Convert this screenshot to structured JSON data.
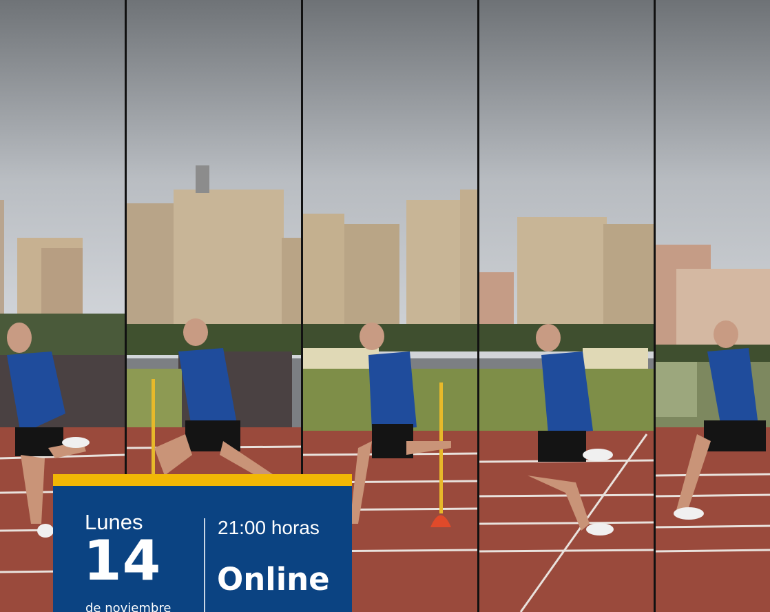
{
  "event": {
    "weekday": "Lunes",
    "day_number": "14",
    "month": "de noviembre",
    "time": "21:00 horas",
    "mode": "Online"
  },
  "colors": {
    "brand_blue": "#0b4382",
    "accent_yellow": "#f2b705",
    "top_bar": "#0b3f7a"
  },
  "photos": [
    {
      "frame": "sprint-frame-1"
    },
    {
      "frame": "sprint-frame-2"
    },
    {
      "frame": "sprint-frame-3"
    },
    {
      "frame": "sprint-frame-4"
    },
    {
      "frame": "sprint-frame-5"
    }
  ]
}
